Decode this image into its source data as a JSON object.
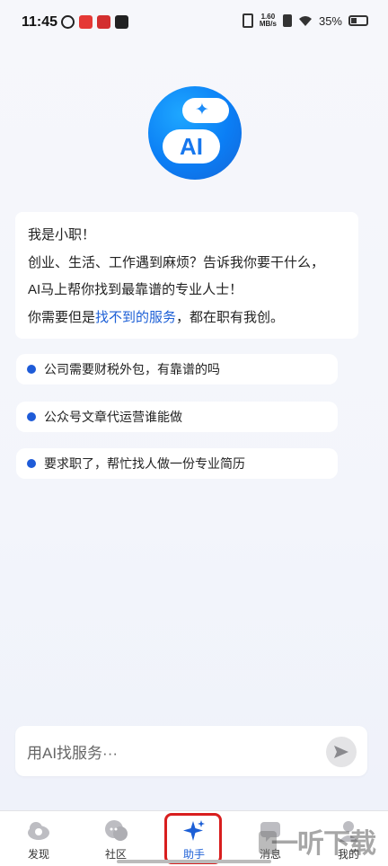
{
  "status_bar": {
    "time": "11:45",
    "net_speed_value": "1.60",
    "net_speed_unit": "MB/s",
    "battery": "35%"
  },
  "intro": {
    "line1": "我是小职！",
    "line2": "创业、生活、工作遇到麻烦？告诉我你要干什么，",
    "line3": "AI马上帮你找到最靠谱的专业人士！",
    "line4_before": "你需要但是",
    "line4_link": "找不到的服务",
    "line4_after": "，都在职有我创。"
  },
  "ai_logo_text": "AI",
  "suggestions": [
    "公司需要财税外包，有靠谱的吗",
    "公众号文章代运营谁能做",
    "要求职了，帮忙找人做一份专业简历"
  ],
  "input": {
    "placeholder": "用AI找服务···"
  },
  "tabs": [
    {
      "label": "发现",
      "icon": "cloud-search-icon"
    },
    {
      "label": "社区",
      "icon": "chat-bubbles-icon"
    },
    {
      "label": "助手",
      "icon": "sparkle-icon",
      "active": true
    },
    {
      "label": "消息",
      "icon": "message-icon"
    },
    {
      "label": "我的",
      "icon": "person-icon"
    }
  ],
  "watermark": "一听下载",
  "colors": {
    "accent": "#1c5fd6",
    "logo_blue": "#0b7ef5",
    "highlight_frame": "#d81e1e"
  }
}
